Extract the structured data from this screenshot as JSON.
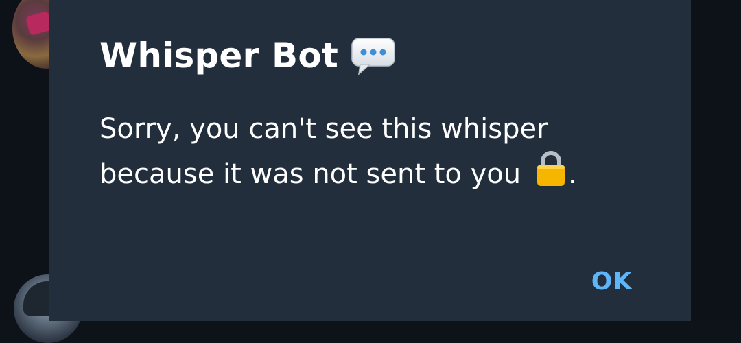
{
  "dialog": {
    "title": "Whisper Bot",
    "title_icon": "speech-bubble-icon",
    "message_line1": "Sorry, you can't see this whisper",
    "message_line2": "because it was not sent to you",
    "message_icon": "lock-icon",
    "message_end": ".",
    "ok_label": "OK"
  },
  "colors": {
    "dialog_bg": "#232e3c",
    "backdrop": "#0d1218",
    "text": "#ffffff",
    "accent": "#5eb5f7"
  }
}
